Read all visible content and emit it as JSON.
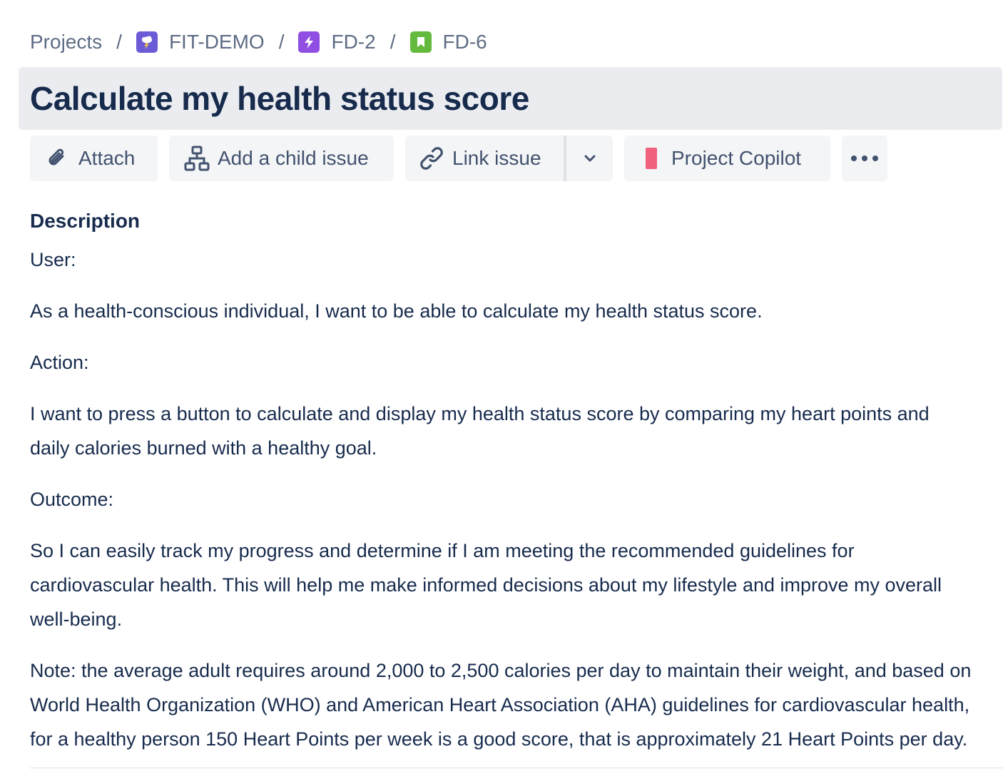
{
  "breadcrumb": {
    "items": [
      {
        "label": "Projects",
        "icon": ""
      },
      {
        "label": "FIT-DEMO",
        "icon": "project-avatar-icon"
      },
      {
        "label": "FD-2",
        "icon": "epic-icon"
      },
      {
        "label": "FD-6",
        "icon": "story-icon"
      }
    ],
    "separator": "/"
  },
  "issue": {
    "title": "Calculate my health status score"
  },
  "toolbar": {
    "attach_label": "Attach",
    "child_label": "Add a child issue",
    "link_label": "Link issue",
    "copilot_label": "Project Copilot"
  },
  "description": {
    "heading": "Description",
    "paragraphs": [
      "User:",
      "As a health-conscious individual, I want to be able to calculate my health status score.",
      "Action:",
      "I want to press a button to calculate and display my health status score by comparing my heart points and daily calories burned with a healthy goal.",
      "Outcome:",
      "So I can easily track my progress and determine if I am meeting the recommended guidelines for cardiovascular health. This will help me make informed decisions about my lifestyle and improve my overall well-being.",
      "Note: the average adult requires around 2,000 to 2,500 calories per day to maintain their weight, and based on World Health Organization (WHO) and American Heart Association (AHA) guidelines for cardiovascular health, for a healthy person 150 Heart Points per week is a good score, that is approximately 21 Heart Points per day."
    ]
  },
  "colors": {
    "text_primary": "#172b4d",
    "text_secondary": "#5e6c84",
    "button_bg": "#f4f5f7",
    "title_bg": "#ebecf0",
    "project_icon": "#6b5bd6",
    "epic_icon": "#904ee2",
    "story_icon": "#63ba3c",
    "copilot_icon": "#f0617d"
  }
}
